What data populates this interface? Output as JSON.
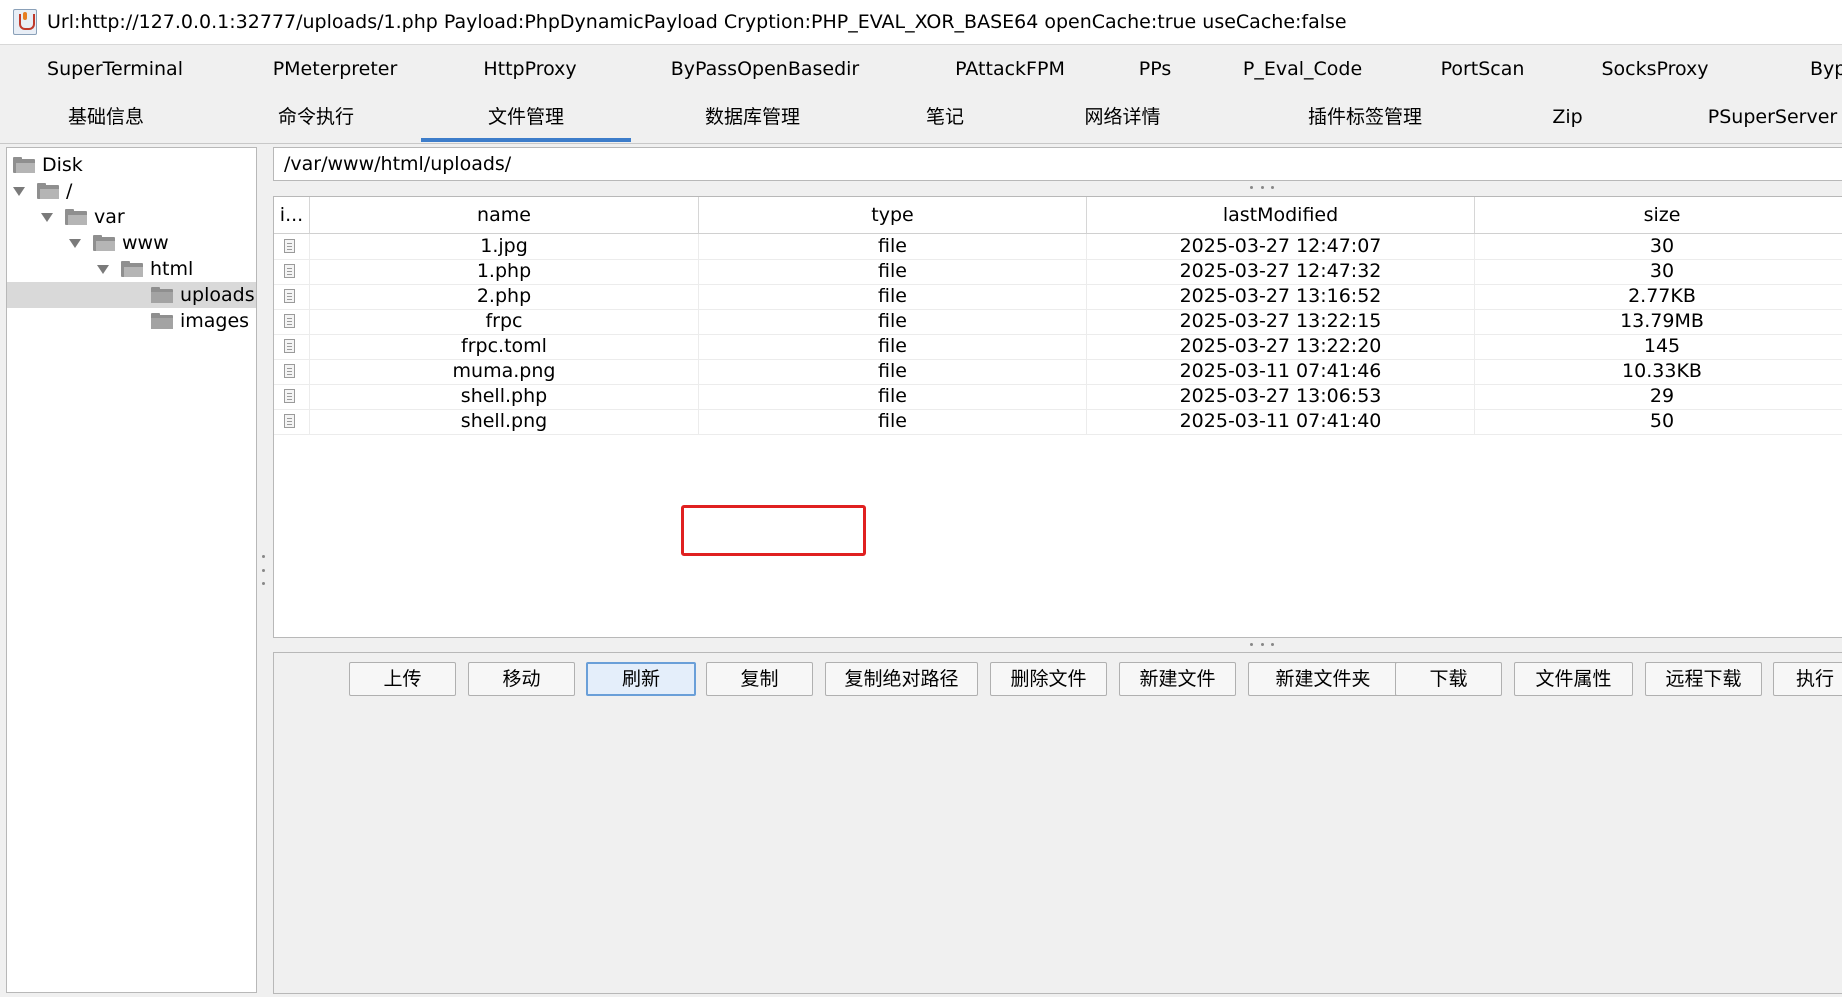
{
  "window": {
    "title": "Url:http://127.0.0.1:32777/uploads/1.php Payload:PhpDynamicPayload Cryption:PHP_EVAL_XOR_BASE64 openCache:true useCache:false",
    "icon": "java-cup-icon"
  },
  "tabs_row1": [
    "SuperTerminal",
    "PMeterpreter",
    "HttpProxy",
    "ByPassOpenBasedir",
    "PAttackFPM",
    "PPs",
    "P_Eval_Code",
    "PortScan",
    "SocksProxy",
    "Byp"
  ],
  "tabs_row2": [
    "基础信息",
    "命令执行",
    "文件管理",
    "数据库管理",
    "笔记",
    "网络详情",
    "插件标签管理",
    "Zip",
    "PSuperServer"
  ],
  "active_tab": "文件管理",
  "tree": {
    "nodes": [
      "Disk",
      "/",
      "var",
      "www",
      "html",
      "uploads",
      "images"
    ],
    "selected": "uploads"
  },
  "path": "/var/www/html/uploads/",
  "table": {
    "columns": [
      "i...",
      "name",
      "type",
      "lastModified",
      "size"
    ],
    "rows": [
      {
        "name": "1.jpg",
        "type": "file",
        "lastModified": "2025-03-27 12:47:07",
        "size": "30"
      },
      {
        "name": "1.php",
        "type": "file",
        "lastModified": "2025-03-27 12:47:32",
        "size": "30"
      },
      {
        "name": "2.php",
        "type": "file",
        "lastModified": "2025-03-27 13:16:52",
        "size": "2.77KB"
      },
      {
        "name": "frpc",
        "type": "file",
        "lastModified": "2025-03-27 13:22:15",
        "size": "13.79MB"
      },
      {
        "name": "frpc.toml",
        "type": "file",
        "lastModified": "2025-03-27 13:22:20",
        "size": "145"
      },
      {
        "name": "muma.png",
        "type": "file",
        "lastModified": "2025-03-11 07:41:46",
        "size": "10.33KB"
      },
      {
        "name": "shell.php",
        "type": "file",
        "lastModified": "2025-03-27 13:06:53",
        "size": "29"
      },
      {
        "name": "shell.png",
        "type": "file",
        "lastModified": "2025-03-11 07:41:40",
        "size": "50"
      }
    ],
    "highlighted_rows": [
      "frpc",
      "frpc.toml"
    ]
  },
  "buttons": [
    "上传",
    "移动",
    "刷新",
    "复制",
    "复制绝对路径",
    "删除文件",
    "新建文件",
    "新建文件夹",
    "下载",
    "文件属性",
    "远程下载",
    "执行"
  ],
  "focused_button": "刷新",
  "colors": {
    "active_tab_underline": "#3d7dca",
    "highlight_box": "#e02020",
    "selection": "#d9d9d9"
  }
}
